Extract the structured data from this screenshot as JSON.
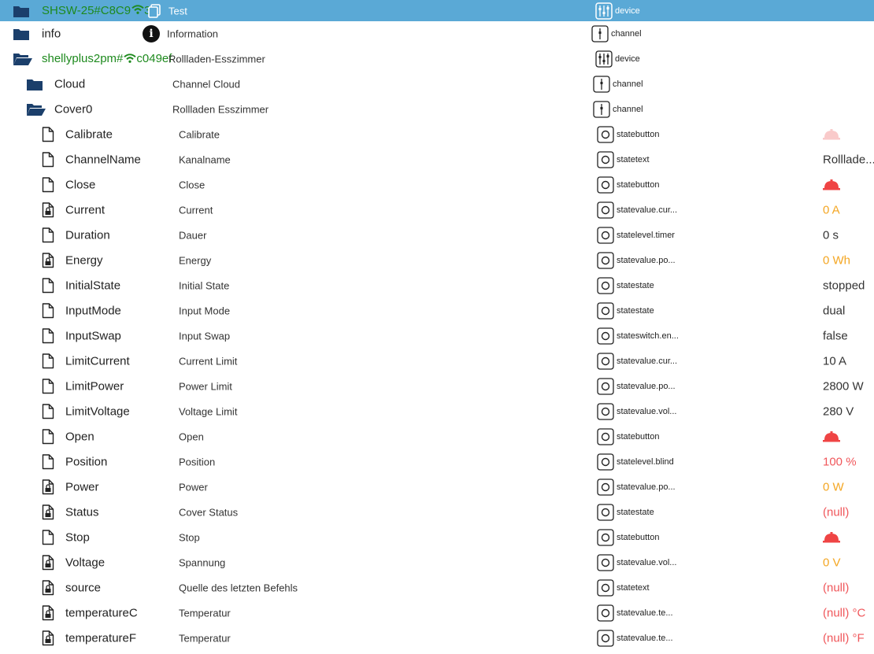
{
  "rows": {
    "r0": {
      "name": "SHSW-25#C8C9",
      "name_suffix": "3",
      "desc": "Test",
      "role": "device"
    },
    "r1": {
      "name": "info",
      "desc": "Information",
      "role": "channel"
    },
    "r2": {
      "name": "shellyplus2pm#",
      "name_suffix": "c049ef",
      "desc": "Rollladen-Esszimmer",
      "role": "device"
    },
    "r3": {
      "name": "Cloud",
      "desc": "Channel Cloud",
      "role": "channel"
    },
    "r4": {
      "name": "Cover0",
      "desc": "Rollladen Esszimmer",
      "role": "channel"
    },
    "s0": {
      "name": "Calibrate",
      "desc": "Calibrate",
      "role": "statebutton"
    },
    "s1": {
      "name": "ChannelName",
      "desc": "Kanalname",
      "role": "statetext",
      "value": "Rolllade..."
    },
    "s2": {
      "name": "Close",
      "desc": "Close",
      "role": "statebutton"
    },
    "s3": {
      "name": "Current",
      "desc": "Current",
      "role": "statevalue.cur...",
      "value": "0 A"
    },
    "s4": {
      "name": "Duration",
      "desc": "Dauer",
      "role": "statelevel.timer",
      "value": "0 s"
    },
    "s5": {
      "name": "Energy",
      "desc": "Energy",
      "role": "statevalue.po...",
      "value": "0 Wh"
    },
    "s6": {
      "name": "InitialState",
      "desc": "Initial State",
      "role": "statestate",
      "value": "stopped"
    },
    "s7": {
      "name": "InputMode",
      "desc": "Input Mode",
      "role": "statestate",
      "value": "dual"
    },
    "s8": {
      "name": "InputSwap",
      "desc": "Input Swap",
      "role": "stateswitch.en...",
      "value": "false"
    },
    "s9": {
      "name": "LimitCurrent",
      "desc": "Current Limit",
      "role": "statevalue.cur...",
      "value": "10 A"
    },
    "s10": {
      "name": "LimitPower",
      "desc": "Power Limit",
      "role": "statevalue.po...",
      "value": "2800 W"
    },
    "s11": {
      "name": "LimitVoltage",
      "desc": "Voltage Limit",
      "role": "statevalue.vol...",
      "value": "280 V"
    },
    "s12": {
      "name": "Open",
      "desc": "Open",
      "role": "statebutton"
    },
    "s13": {
      "name": "Position",
      "desc": "Position",
      "role": "statelevel.blind",
      "value": "100 %"
    },
    "s14": {
      "name": "Power",
      "desc": "Power",
      "role": "statevalue.po...",
      "value": "0 W"
    },
    "s15": {
      "name": "Status",
      "desc": "Cover Status",
      "role": "statestate",
      "value": "(null)"
    },
    "s16": {
      "name": "Stop",
      "desc": "Stop",
      "role": "statebutton"
    },
    "s17": {
      "name": "Voltage",
      "desc": "Spannung",
      "role": "statevalue.vol...",
      "value": "0 V"
    },
    "s18": {
      "name": "source",
      "desc": "Quelle des letzten Befehls",
      "role": "statetext",
      "value": "(null)"
    },
    "s19": {
      "name": "temperatureC",
      "desc": "Temperatur",
      "role": "statevalue.te...",
      "value": "(null) °C"
    },
    "s20": {
      "name": "temperatureF",
      "desc": "Temperatur",
      "role": "statevalue.te...",
      "value": "(null) °F"
    }
  },
  "colors": {
    "selected_bg": "#5aa9d6",
    "folder": "#1b3f6b",
    "online_green": "#1e8a1e",
    "value_orange": "#f4a622",
    "value_red": "#f0575b",
    "button_light": "#f9caca",
    "button_red": "#ef4444"
  },
  "icons": {
    "folder": "folder-icon",
    "folder_open": "folder-open-icon",
    "file": "file-icon",
    "file_locked": "file-lock-icon",
    "device_role": "device-sliders-icon",
    "channel_role": "channel-slider-icon",
    "state_role": "state-circle-icon",
    "wifi": "wifi-icon",
    "button": "bell-button-icon"
  }
}
